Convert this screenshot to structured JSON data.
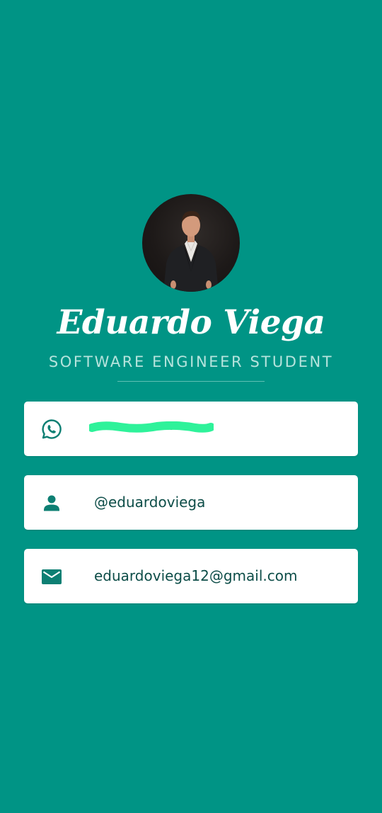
{
  "profile": {
    "name": "Eduardo Viega",
    "title": "SOFTWARE ENGINEER STUDENT"
  },
  "contacts": [
    {
      "icon": "whatsapp-icon",
      "value": "•••• •• •••••"
    },
    {
      "icon": "person-icon",
      "value": "@eduardoviega"
    },
    {
      "icon": "email-icon",
      "value": "eduardoviega12@gmail.com"
    }
  ],
  "colors": {
    "background": "#009485",
    "card": "#ffffff",
    "icon": "#0d7f73",
    "text": "#0d4d48",
    "subtitle": "#b6e4dd",
    "redaction": "#2ef29a"
  }
}
